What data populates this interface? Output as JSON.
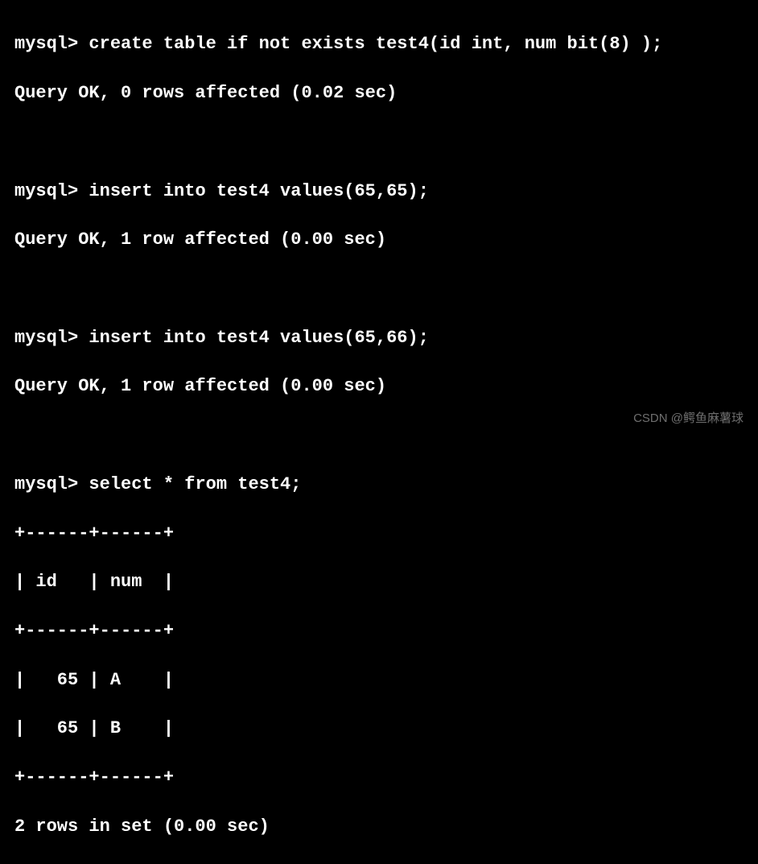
{
  "session": {
    "prompt": "mysql> ",
    "commands": [
      {
        "input": "create table if not exists test4(id int, num bit(8) );",
        "output": "Query OK, 0 rows affected (0.02 sec)"
      },
      {
        "input": "insert into test4 values(65,65);",
        "output": "Query OK, 1 row affected (0.00 sec)"
      },
      {
        "input": "insert into test4 values(65,66);",
        "output": "Query OK, 1 row affected (0.00 sec)"
      }
    ],
    "select": {
      "input": "select * from test4;",
      "border": "+------+------+",
      "header": "| id   | num  |",
      "rows": [
        "|   65 | A    |",
        "|   65 | B    |"
      ],
      "footer": "2 rows in set (0.00 sec)"
    }
  },
  "watermark": "CSDN @鳄鱼麻薯球"
}
